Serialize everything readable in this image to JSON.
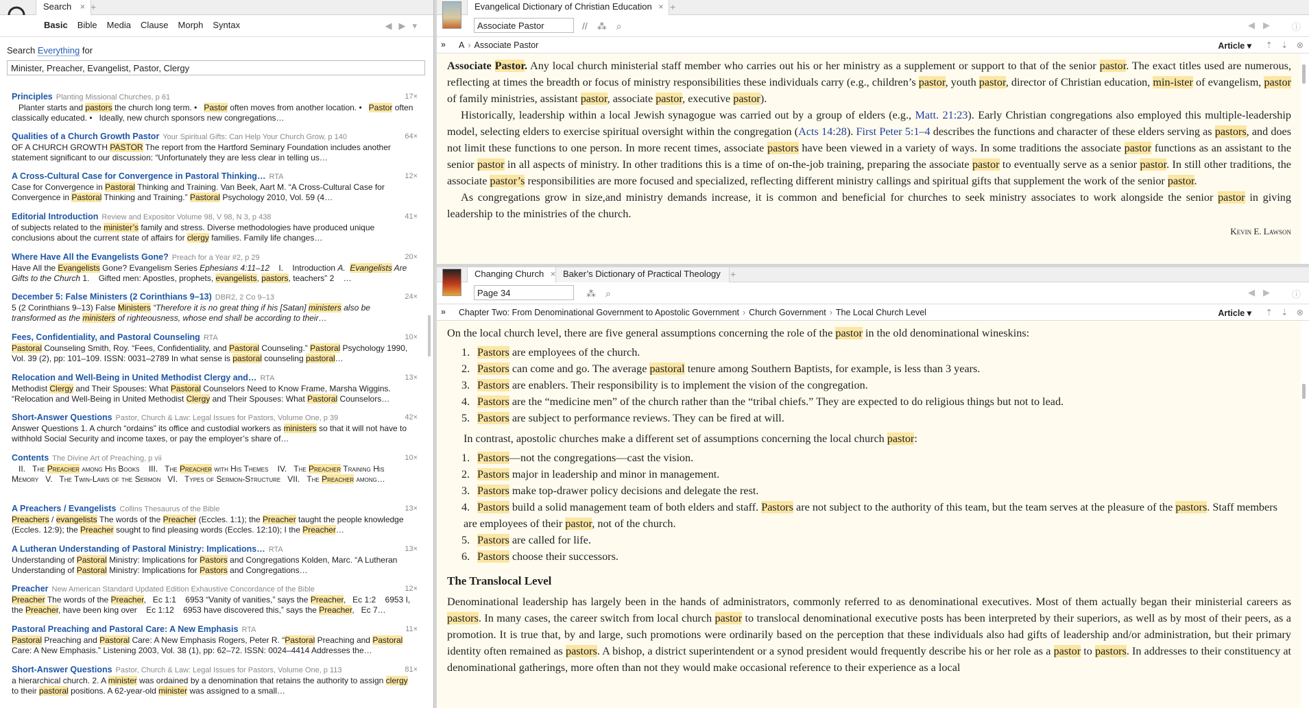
{
  "left": {
    "tab_label": "Search",
    "modes": [
      "Basic",
      "Bible",
      "Media",
      "Clause",
      "Morph",
      "Syntax"
    ],
    "search_prefix": "Search",
    "search_scope": "Everything",
    "search_suffix": "for",
    "query": "Minister, Preacher, Evangelist, Pastor, Clergy",
    "results": [
      {
        "title": "Principles",
        "source": "Planting Missional Churches, p 61",
        "count": "17×",
        "snippet": "Planter starts and pastors the church long term. •  Pastor often moves from another location. •  Pastor often classically educated. •  Ideally, new church sponsors new congregations…"
      },
      {
        "title": "Qualities of a Church Growth Pastor",
        "source": "Your Spiritual Gifts: Can Help Your Church Grow, p 140",
        "count": "64×",
        "snippet": "OF A CHURCH GROWTH PASTOR The report from the Hartford Seminary Foundation includes another statement significant to our discussion: “Unfortunately they are less clear in telling us…"
      },
      {
        "title": "A Cross-Cultural Case for Convergence in Pastoral Thinking…",
        "source": "RTA",
        "count": "12×",
        "snippet": "Case for Convergence in Pastoral Thinking and Training. Van Beek, Aart M. “A Cross-Cultural Case for Convergence in Pastoral Thinking and Training.” Pastoral Psychology 2010, Vol. 59 (4…"
      },
      {
        "title": "Editorial Introduction",
        "source": "Review and Expositor Volume 98, V 98, N 3, p 438",
        "count": "41×",
        "snippet": "of subjects related to the minister’s family and stress. Diverse methodologies have produced unique conclusions about the current state of affairs for clergy families. Family life changes…"
      },
      {
        "title": "Where Have All the Evangelists Gone?",
        "source": "Preach for a Year #2, p 29",
        "count": "20×",
        "snippet": "Have All the Evangelists Gone? Evangelism Series Ephesians 4:11–12    I.    Introduction A.  Evangelists Are Gifts to the Church 1.    Gifted men: Apostles, prophets, evangelists, pastors, teachers” 2    …"
      },
      {
        "title": "December 5: False Ministers (2 Corinthians 9–13)",
        "source": "DBR2, 2 Co 9–13",
        "count": "24×",
        "snippet": "5 (2 Corinthians 9–13) False Ministers “Therefore it is no great thing if his [Satan] ministers also be transformed as the ministers of righteousness, whose end shall be according to their…"
      },
      {
        "title": "Fees, Confidentiality, and Pastoral Counseling",
        "source": "RTA",
        "count": "10×",
        "snippet": "Pastoral Counseling Smith, Roy. “Fees, Confidentiality, and Pastoral Counseling.” Pastoral Psychology 1990, Vol. 39 (2), pp: 101–109. ISSN: 0031–2789 In what sense is pastoral counseling pastoral…"
      },
      {
        "title": "Relocation and Well-Being in United Methodist Clergy and…",
        "source": "RTA",
        "count": "13×",
        "snippet": "Methodist Clergy and Their Spouses: What Pastoral Counselors Need to Know Frame, Marsha Wiggins. “Relocation and Well-Being in United Methodist Clergy and Their Spouses: What Pastoral Counselors…"
      },
      {
        "title": "Short-Answer Questions",
        "source": "Pastor, Church & Law: Legal Issues for Pastors, Volume One, p 39",
        "count": "42×",
        "snippet": "Answer Questions 1. A church “ordains” its office and custodial workers as ministers so that it will not have to withhold Social Security and income taxes, or pay the employer’s share of…"
      },
      {
        "title": "Contents",
        "source": "The Divine Art of Preaching, p vii",
        "count": "10×",
        "snippet": "II.  THE PREACHER AMONG HIS BOOKS   III.  THE PREACHER WITH HIS THEMES   IV.  THE PREACHER TRAINING HIS MEMORY   V.  THE TWIN-LAWS OF THE SERMON   VI.  TYPES OF SERMON-STRUCTURE   VII.  THE PREACHER AMONG…"
      },
      {
        "title": "A Preachers / Evangelists",
        "source": "Collins Thesaurus of the Bible",
        "count": "13×",
        "snippet": "Preachers / evangelists The words of the Preacher (Eccles. 1:1); the Preacher taught the people knowledge (Eccles. 12:9); the Preacher sought to find pleasing words (Eccles. 12:10); I the Preacher…"
      },
      {
        "title": "A Lutheran Understanding of Pastoral Ministry: Implications…",
        "source": "RTA",
        "count": "13×",
        "snippet": "Understanding of Pastoral Ministry: Implications for Pastors and Congregations Kolden, Marc. “A Lutheran Understanding of Pastoral Ministry: Implications for Pastors and Congregations…"
      },
      {
        "title": "Preacher",
        "source": "New American Standard Updated Edition Exhaustive Concordance of the Bible",
        "count": "12×",
        "snippet": "Preacher The words of the Preacher,   Ec 1:1    6953 “Vanity of vanities,” says the Preacher,   Ec 1:2    6953 I, the Preacher, have been king over    Ec 1:12    6953 have discovered this,” says the Preacher,   Ec 7…"
      },
      {
        "title": "Pastoral Preaching and Pastoral Care: A New Emphasis",
        "source": "RTA",
        "count": "11×",
        "snippet": "Pastoral Preaching and Pastoral Care: A New Emphasis Rogers, Peter R. “Pastoral Preaching and Pastoral Care: A New Emphasis.” Listening 2003, Vol. 38 (1), pp: 62–72. ISSN: 0024–4414 Addresses the…"
      },
      {
        "title": "Short-Answer Questions",
        "source": "Pastor, Church & Law: Legal Issues for Pastors, Volume One, p 113",
        "count": "81×",
        "snippet": "a hierarchical church. 2. A minister was ordained by a denomination that retains the authority to assign clergy to their pastoral positions. A 62-year-old minister was assigned to a small…"
      }
    ]
  },
  "pane1": {
    "tab_label": "Evangelical Dictionary of Christian Education",
    "nav_value": "Associate Pastor",
    "crumb_letter": "A",
    "crumb_entry": "Associate Pastor",
    "view_label": "Article",
    "author": "Kevin E. Lawson"
  },
  "pane2": {
    "tab1_label": "Changing Church",
    "tab2_label": "Baker’s Dictionary of Practical Theology",
    "nav_value": "Page 34",
    "crumbs": [
      "Chapter Two: From Denominational Government to Apostolic Government",
      "Church Government",
      "The Local Church Level"
    ],
    "view_label": "Article",
    "heading": "The Translocal Level"
  }
}
